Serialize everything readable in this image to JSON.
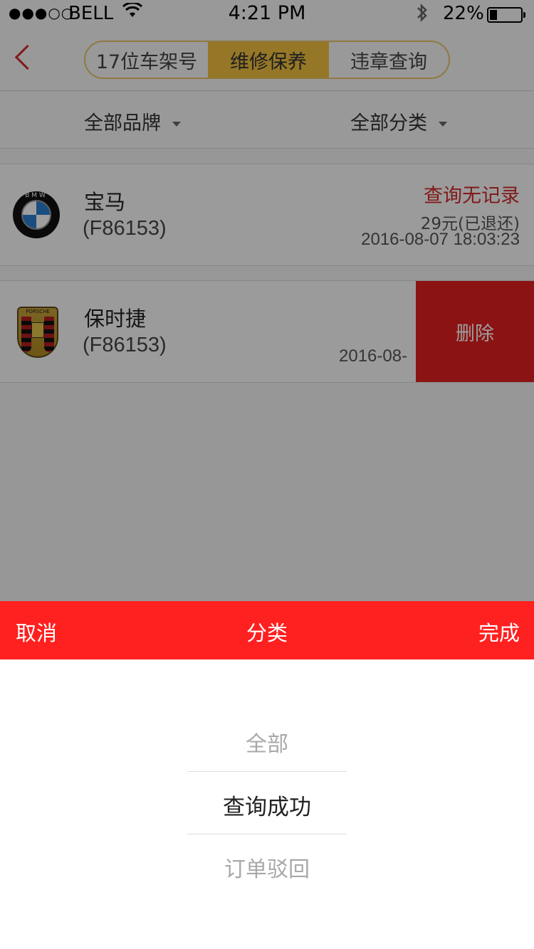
{
  "status_bar": {
    "signal": "●●●○○",
    "carrier": "BELL",
    "time": "4:21 PM",
    "battery": "22%",
    "battery_level": 0.22
  },
  "nav": {
    "tabs": [
      {
        "label": "17位车架号",
        "selected": false
      },
      {
        "label": "维修保养",
        "selected": true
      },
      {
        "label": "违章查询",
        "selected": false
      }
    ],
    "accent_color": "#f0c040"
  },
  "filters": {
    "brand": "全部品牌",
    "category": "全部分类"
  },
  "records": [
    {
      "brand": "宝马",
      "code": "(F86153)",
      "status": "查询无记录",
      "price": "29元(已退还)",
      "datetime": "2016-08-07 18:03:23",
      "logo": "bmw-logo"
    },
    {
      "brand": "保时捷",
      "code": "(F86153)",
      "datetime": "2016-08-",
      "delete_label": "删除",
      "logo": "porsche-logo"
    }
  ],
  "picker": {
    "cancel": "取消",
    "title": "分类",
    "done": "完成",
    "options": [
      "全部",
      "查询成功",
      "订单驳回"
    ],
    "selected_index": 1,
    "bar_color": "#ff2020"
  }
}
